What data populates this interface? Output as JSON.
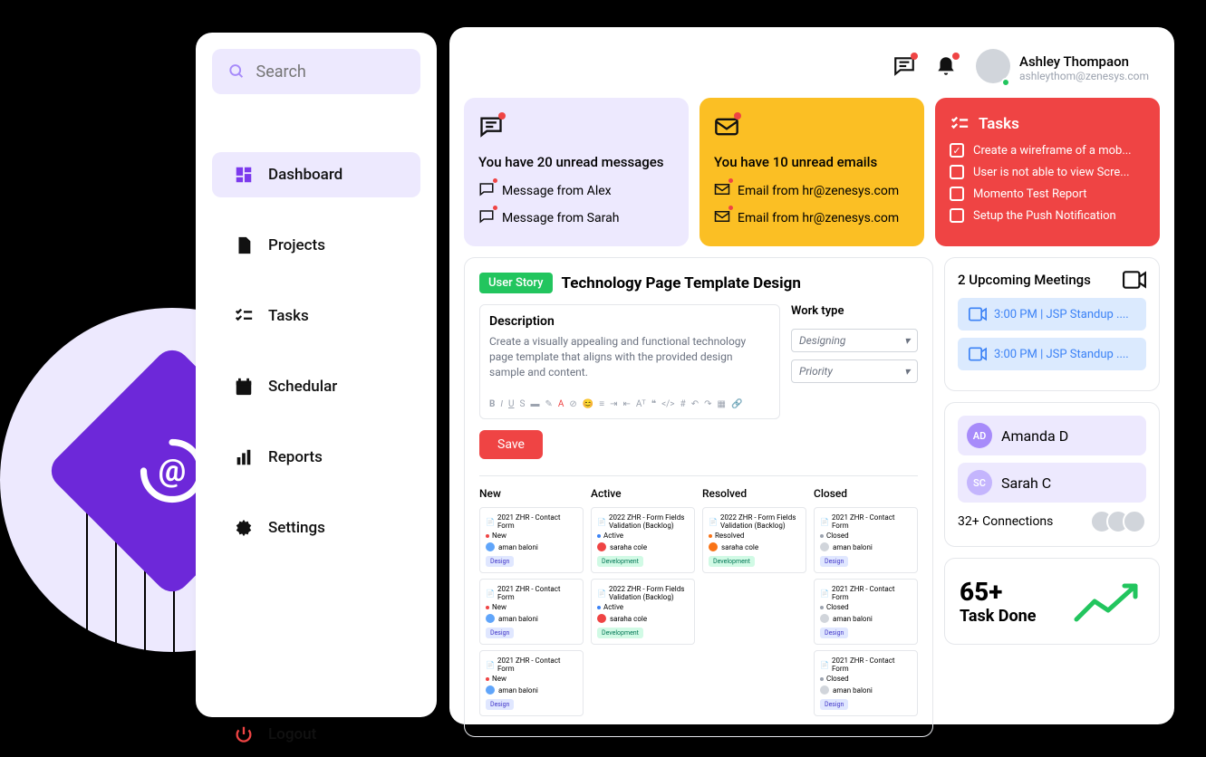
{
  "search": {
    "placeholder": "Search"
  },
  "nav": {
    "dashboard": "Dashboard",
    "projects": "Projects",
    "tasks": "Tasks",
    "schedular": "Schedular",
    "reports": "Reports",
    "settings": "Settings",
    "logout": "Logout"
  },
  "user": {
    "name": "Ashley Thompaon",
    "email": "ashleythom@zenesys.com"
  },
  "messages": {
    "title": "You have 20 unread messages",
    "items": [
      "Message from Alex",
      "Message from Sarah"
    ]
  },
  "emails": {
    "title": "You have 10 unread emails",
    "items": [
      "Email from hr@zenesys.com",
      "Email from hr@zenesys.com"
    ]
  },
  "tasks_card": {
    "title": "Tasks",
    "items": [
      {
        "label": "Create a wireframe of a mob...",
        "checked": true
      },
      {
        "label": "User is not able to view Scre...",
        "checked": false
      },
      {
        "label": "Momento Test Report",
        "checked": false
      },
      {
        "label": "Setup the Push Notification",
        "checked": false
      }
    ]
  },
  "story": {
    "badge": "User Story",
    "title": "Technology Page Template Design",
    "desc_label": "Description",
    "desc_text": "Create a visually appealing and functional technology page template that aligns with the provided design sample and content.",
    "work_type_label": "Work type",
    "work_type": "Designing",
    "priority": "Priority",
    "save": "Save"
  },
  "kanban": {
    "cols": [
      "New",
      "Active",
      "Resolved",
      "Closed"
    ],
    "new": [
      {
        "title": "2021 ZHR - Contact Form",
        "status": "New",
        "user": "aman baloni",
        "tag": "Design"
      },
      {
        "title": "2021 ZHR - Contact Form",
        "status": "New",
        "user": "aman baloni",
        "tag": "Design"
      },
      {
        "title": "2021 ZHR - Contact Form",
        "status": "New",
        "user": "aman baloni",
        "tag": "Design"
      }
    ],
    "active": [
      {
        "title": "2022 ZHR - Form Fields Validation (Backlog)",
        "status": "Active",
        "user": "saraha cole",
        "tag": "Development"
      },
      {
        "title": "2022 ZHR - Form Fields Validation (Backlog)",
        "status": "Active",
        "user": "saraha cole",
        "tag": "Development"
      }
    ],
    "resolved": [
      {
        "title": "2022 ZHR - Form Fields Validation (Backlog)",
        "status": "Resolved",
        "user": "saraha cole",
        "tag": "Development"
      }
    ],
    "closed": [
      {
        "title": "2021 ZHR - Contact Form",
        "status": "Closed",
        "user": "aman baloni",
        "tag": "Design"
      },
      {
        "title": "2021 ZHR - Contact Form",
        "status": "Closed",
        "user": "aman baloni",
        "tag": "Design"
      },
      {
        "title": "2021 ZHR - Contact Form",
        "status": "Closed",
        "user": "aman baloni",
        "tag": "Design"
      }
    ]
  },
  "meetings": {
    "title": "2 Upcoming Meetings",
    "items": [
      "3:00 PM | JSP Standup ....",
      "3:00 PM | JSP Standup ...."
    ]
  },
  "connections": {
    "items": [
      {
        "initials": "AD",
        "name": "Amanda D",
        "color": "#a78bfa"
      },
      {
        "initials": "SC",
        "name": "Sarah C",
        "color": "#c4b5fd"
      }
    ],
    "count": "32+ Connections"
  },
  "taskdone": {
    "num": "65+",
    "label": "Task Done"
  }
}
